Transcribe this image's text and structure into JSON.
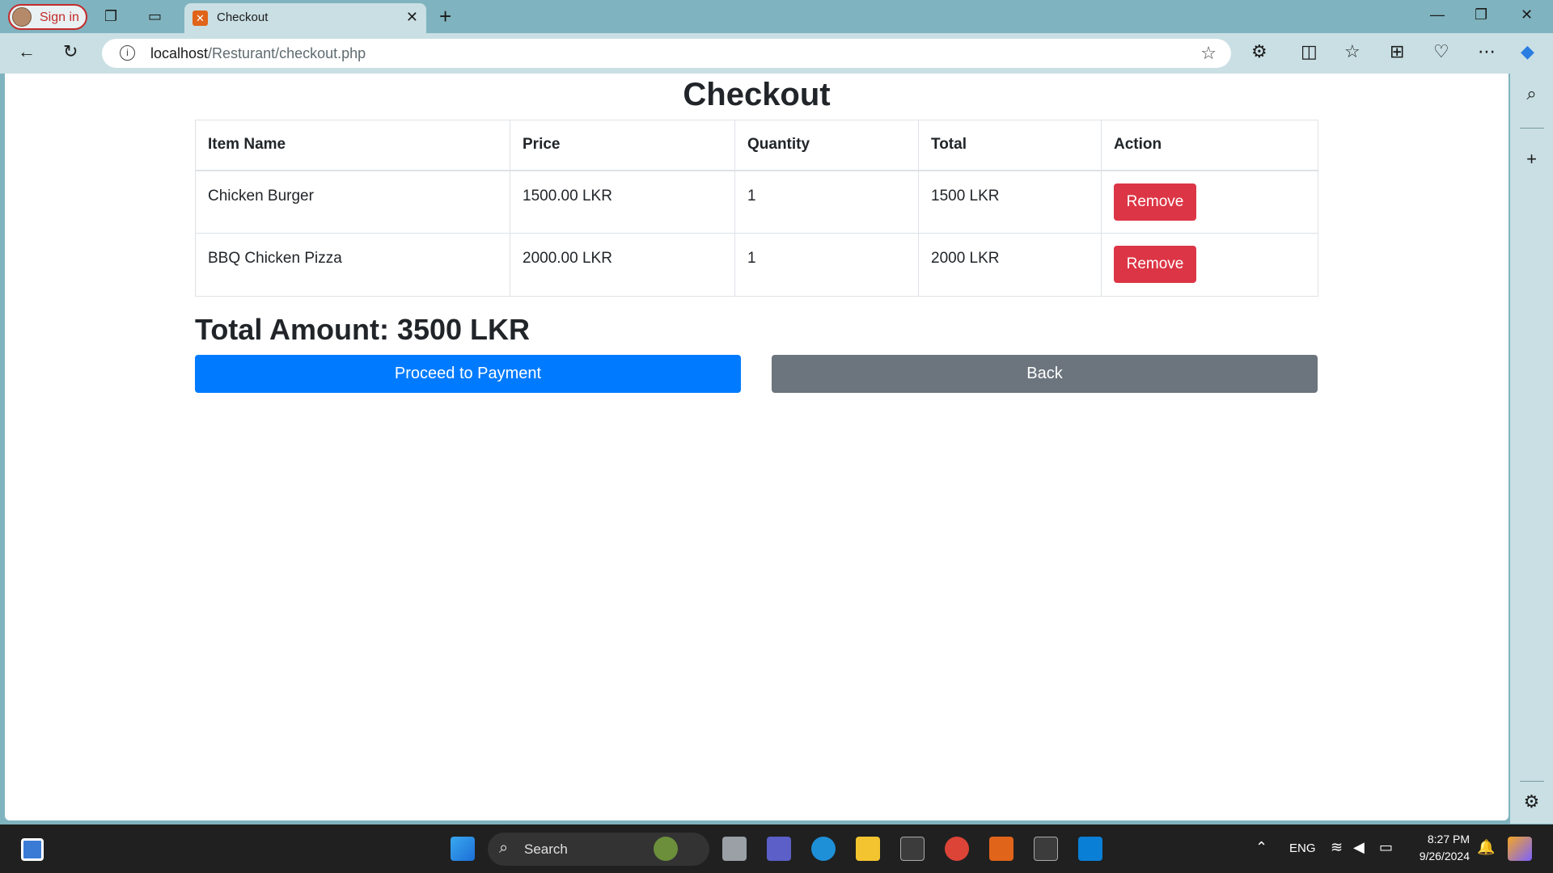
{
  "browser": {
    "signin_label": "Sign in",
    "tab_title": "Checkout",
    "url_host": "localhost",
    "url_path": "/Resturant/checkout.php"
  },
  "page": {
    "title": "Checkout",
    "table": {
      "headers": [
        "Item Name",
        "Price",
        "Quantity",
        "Total",
        "Action"
      ],
      "rows": [
        {
          "name": "Chicken Burger",
          "price": "1500.00 LKR",
          "quantity": "1",
          "total": "1500 LKR",
          "action": "Remove"
        },
        {
          "name": "BBQ Chicken Pizza",
          "price": "2000.00 LKR",
          "quantity": "1",
          "total": "2000 LKR",
          "action": "Remove"
        }
      ]
    },
    "total_amount": "Total Amount: 3500 LKR",
    "pay_button": "Proceed to Payment",
    "back_button": "Back"
  },
  "taskbar": {
    "search_label": "Search",
    "language": "ENG",
    "time": "8:27 PM",
    "date": "9/26/2024"
  },
  "colors": {
    "primary": "#007bff",
    "danger": "#dc3545",
    "secondary": "#6c757d",
    "chrome": "#7fb3bf"
  }
}
